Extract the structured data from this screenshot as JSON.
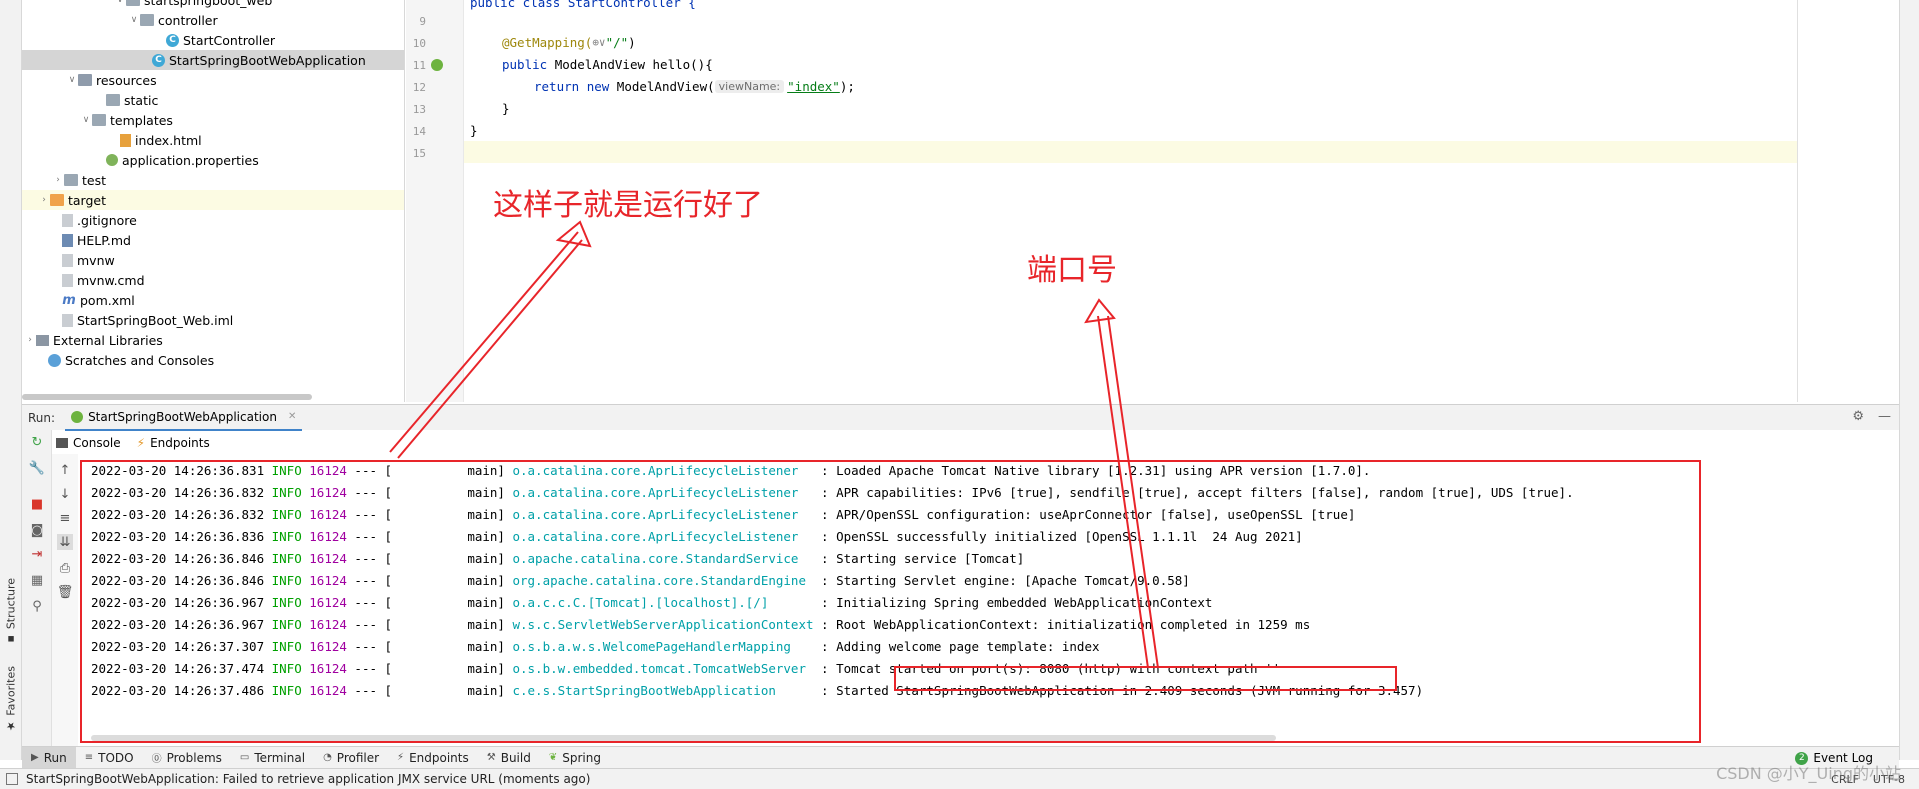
{
  "left_bar": {
    "structure_label": "Structure",
    "favorites_label": "Favorites"
  },
  "tree": {
    "items": [
      {
        "label": "startspringboot_web",
        "icon": "folder-icon"
      },
      {
        "label": "controller",
        "icon": "folder-icon"
      },
      {
        "label": "StartController",
        "icon": "class-icon"
      },
      {
        "label": "StartSpringBootWebApplication",
        "icon": "spring-class-icon"
      },
      {
        "label": "resources",
        "icon": "resources-folder-icon"
      },
      {
        "label": "static",
        "icon": "folder-icon"
      },
      {
        "label": "templates",
        "icon": "folder-icon"
      },
      {
        "label": "index.html",
        "icon": "html-file-icon"
      },
      {
        "label": "application.properties",
        "icon": "properties-file-icon"
      },
      {
        "label": "test",
        "icon": "folder-icon"
      },
      {
        "label": "target",
        "icon": "excluded-folder-icon"
      },
      {
        "label": ".gitignore",
        "icon": "file-icon"
      },
      {
        "label": "HELP.md",
        "icon": "markdown-file-icon"
      },
      {
        "label": "mvnw",
        "icon": "file-icon"
      },
      {
        "label": "mvnw.cmd",
        "icon": "file-icon"
      },
      {
        "label": "pom.xml",
        "icon": "maven-file-icon"
      },
      {
        "label": "StartSpringBoot_Web.iml",
        "icon": "module-file-icon"
      },
      {
        "label": "External Libraries",
        "icon": "library-icon"
      },
      {
        "label": "Scratches and Consoles",
        "icon": "scratches-icon"
      }
    ]
  },
  "editor": {
    "line_numbers": [
      "9",
      "10",
      "11",
      "12",
      "13",
      "14",
      "15"
    ],
    "top_partial": "public class StartController {",
    "annotation": "@GetMapping(",
    "annotation_value": "\"/\"",
    "annotation_close": ")",
    "method_kw": "public ",
    "method_rest": "ModelAndView hello(){",
    "return_kw": "return ",
    "new_kw": "new ",
    "return_rest": "ModelAndView(",
    "param_hint": "viewName:",
    "return_value": "\"index\"",
    "return_end": ");",
    "close_inner": "}",
    "close_outer": "}"
  },
  "annotations": {
    "running_ok": "这样子就是运行好了",
    "port_number": "端口号"
  },
  "run_panel": {
    "run_label": "Run:",
    "tab_title": "StartSpringBootWebApplication",
    "sub_tabs": [
      "Console",
      "Endpoints"
    ]
  },
  "console": {
    "lines": [
      {
        "ts": "2022-03-20 14:26:36.831",
        "level": "INFO",
        "pid": "16124",
        "sep": "--- [",
        "thread": "main]",
        "logger": "o.a.catalina.core.AprLifecycleListener",
        "msg": ": Loaded Apache Tomcat Native library [1.2.31] using APR version [1.7.0]."
      },
      {
        "ts": "2022-03-20 14:26:36.832",
        "level": "INFO",
        "pid": "16124",
        "sep": "--- [",
        "thread": "main]",
        "logger": "o.a.catalina.core.AprLifecycleListener",
        "msg": ": APR capabilities: IPv6 [true], sendfile [true], accept filters [false], random [true], UDS [true]."
      },
      {
        "ts": "2022-03-20 14:26:36.832",
        "level": "INFO",
        "pid": "16124",
        "sep": "--- [",
        "thread": "main]",
        "logger": "o.a.catalina.core.AprLifecycleListener",
        "msg": ": APR/OpenSSL configuration: useAprConnector [false], useOpenSSL [true]"
      },
      {
        "ts": "2022-03-20 14:26:36.836",
        "level": "INFO",
        "pid": "16124",
        "sep": "--- [",
        "thread": "main]",
        "logger": "o.a.catalina.core.AprLifecycleListener",
        "msg": ": OpenSSL successfully initialized [OpenSSL 1.1.1l  24 Aug 2021]"
      },
      {
        "ts": "2022-03-20 14:26:36.846",
        "level": "INFO",
        "pid": "16124",
        "sep": "--- [",
        "thread": "main]",
        "logger": "o.apache.catalina.core.StandardService",
        "msg": ": Starting service [Tomcat]"
      },
      {
        "ts": "2022-03-20 14:26:36.846",
        "level": "INFO",
        "pid": "16124",
        "sep": "--- [",
        "thread": "main]",
        "logger": "org.apache.catalina.core.StandardEngine",
        "msg": ": Starting Servlet engine: [Apache Tomcat/9.0.58]"
      },
      {
        "ts": "2022-03-20 14:26:36.967",
        "level": "INFO",
        "pid": "16124",
        "sep": "--- [",
        "thread": "main]",
        "logger": "o.a.c.c.C.[Tomcat].[localhost].[/]",
        "msg": ": Initializing Spring embedded WebApplicationContext"
      },
      {
        "ts": "2022-03-20 14:26:36.967",
        "level": "INFO",
        "pid": "16124",
        "sep": "--- [",
        "thread": "main]",
        "logger": "w.s.c.ServletWebServerApplicationContext",
        "msg": ": Root WebApplicationContext: initialization completed in 1259 ms"
      },
      {
        "ts": "2022-03-20 14:26:37.307",
        "level": "INFO",
        "pid": "16124",
        "sep": "--- [",
        "thread": "main]",
        "logger": "o.s.b.a.w.s.WelcomePageHandlerMapping",
        "msg": ": Adding welcome page template: index"
      },
      {
        "ts": "2022-03-20 14:26:37.474",
        "level": "INFO",
        "pid": "16124",
        "sep": "--- [",
        "thread": "main]",
        "logger": "o.s.b.w.embedded.tomcat.TomcatWebServer",
        "msg": ": Tomcat started on port(s): 8080 (http) with context path ''"
      },
      {
        "ts": "2022-03-20 14:26:37.486",
        "level": "INFO",
        "pid": "16124",
        "sep": "--- [",
        "thread": "main]",
        "logger": "c.e.s.StartSpringBootWebApplication",
        "msg": ": Started StartSpringBootWebApplication in 2.409 seconds (JVM running for 3.457)"
      }
    ]
  },
  "bottom_bar": {
    "items": [
      "Run",
      "TODO",
      "Problems",
      "Terminal",
      "Profiler",
      "Endpoints",
      "Build",
      "Spring"
    ],
    "event_log": "Event Log",
    "event_count": "2"
  },
  "status_bar": {
    "message": "StartSpringBootWebApplication: Failed to retrieve application JMX service URL (moments ago)",
    "line_sep": "CRLF",
    "encoding": "UTF-8"
  },
  "watermark": "CSDN @小Y_Uing的小站",
  "colors": {
    "accent_red": "#e8252a",
    "info_green": "#00a000",
    "pid_magenta": "#a000a0",
    "logger_cyan": "#00a0a8"
  }
}
